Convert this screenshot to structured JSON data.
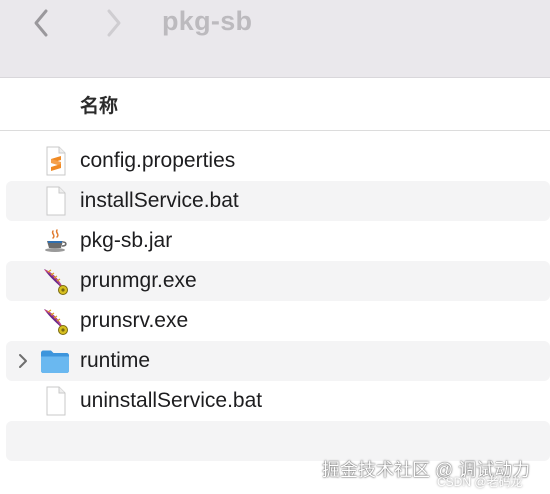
{
  "window": {
    "title": "pkg-sb"
  },
  "toolbar": {
    "back_icon": "chevron-left-icon",
    "forward_icon": "chevron-right-icon"
  },
  "header": {
    "name_column": "名称"
  },
  "files": [
    {
      "name": "config.properties",
      "icon": "sublime-text-file-icon"
    },
    {
      "name": "installService.bat",
      "icon": "generic-document-icon"
    },
    {
      "name": "pkg-sb.jar",
      "icon": "java-coffee-cup-icon"
    },
    {
      "name": "prunmgr.exe",
      "icon": "feather-executable-icon"
    },
    {
      "name": "prunsrv.exe",
      "icon": "feather-executable-icon"
    },
    {
      "name": "runtime",
      "icon": "folder-icon",
      "expandable": true
    },
    {
      "name": "uninstallService.bat",
      "icon": "generic-document-icon"
    }
  ],
  "watermark": {
    "line1": "掘金技术社区 @ 调试动力",
    "line2": "CSDN @老码龙"
  },
  "colors": {
    "toolbar_bg": "#eae8ec",
    "alt_row_bg": "#f4f4f5",
    "folder_blue": "#4aa3e8",
    "sublime_orange": "#f08a24",
    "feather_purple": "#6a2a8a"
  }
}
